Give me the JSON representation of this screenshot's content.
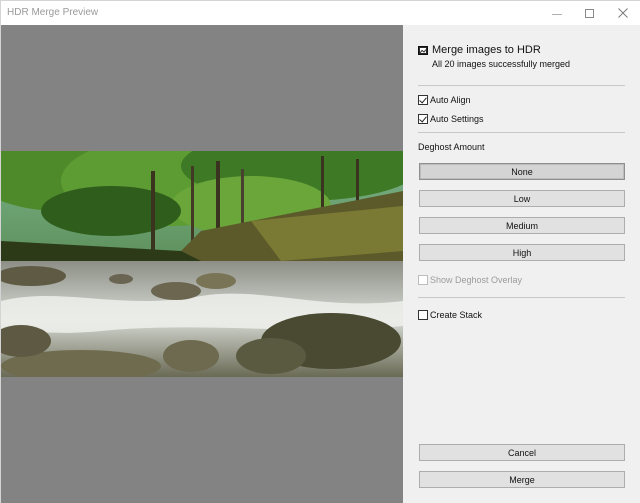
{
  "window": {
    "title": "HDR Merge Preview"
  },
  "panel": {
    "header_title": "Merge images to HDR",
    "header_subtitle": "All 20 images successfully merged",
    "auto_align": {
      "label": "Auto Align",
      "checked": true
    },
    "auto_settings": {
      "label": "Auto Settings",
      "checked": true
    },
    "deghost_label": "Deghost Amount",
    "deghost_options": [
      "None",
      "Low",
      "Medium",
      "High"
    ],
    "deghost_selected": "None",
    "show_overlay": {
      "label": "Show Deghost Overlay",
      "checked": false,
      "enabled": false
    },
    "create_stack": {
      "label": "Create Stack",
      "checked": false
    },
    "cancel_label": "Cancel",
    "merge_label": "Merge"
  },
  "preview": {
    "image_subject": "forest stream with rocks and rapids"
  },
  "colors": {
    "preview_bg": "#838383",
    "panel_bg": "#f0f0f0",
    "button_bg": "#e1e1e1"
  }
}
